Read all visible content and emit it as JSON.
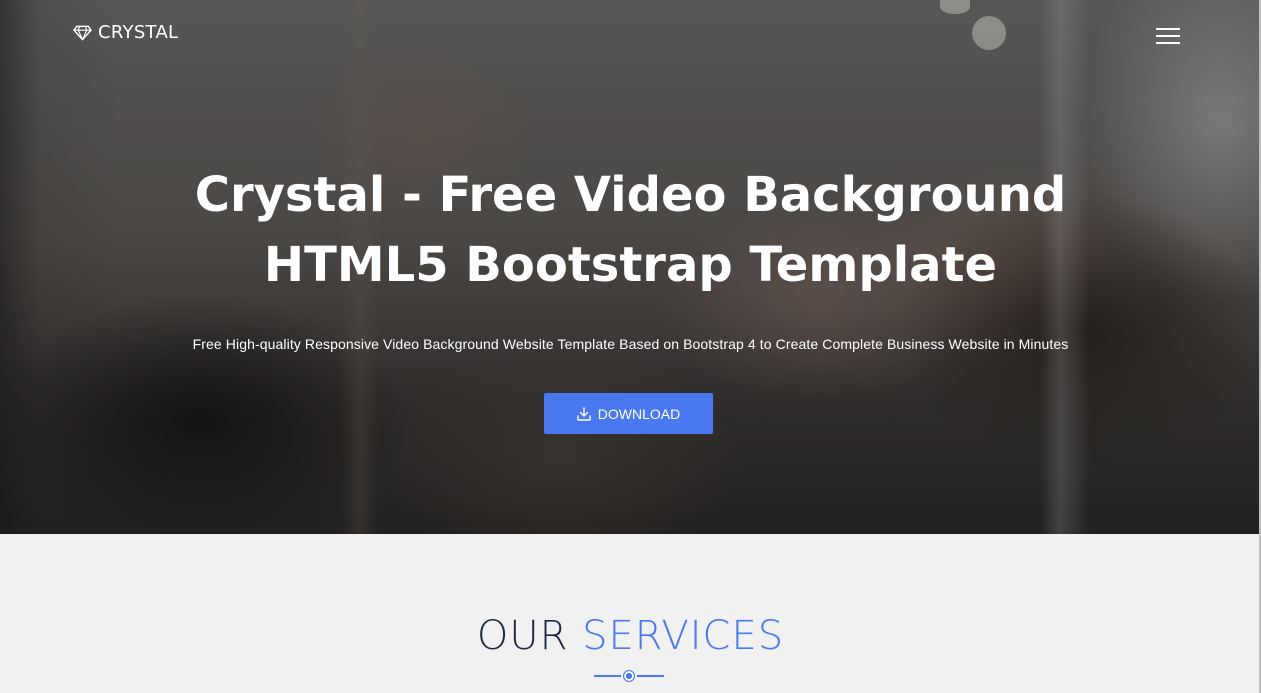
{
  "nav": {
    "brand": "CRYSTAL",
    "brand_icon": "diamond-icon",
    "menu_icon": "hamburger-menu-icon"
  },
  "hero": {
    "title": "Crystal - Free Video Background HTML5 Bootstrap Template",
    "subtitle": "Free High-quality Responsive Video Background Website Template Based on Bootstrap 4 to Create Complete Business Website in Minutes",
    "button_label": "DOWNLOAD",
    "button_icon": "download-icon"
  },
  "services": {
    "title_part1": "OUR",
    "title_part2": "SERVICES"
  },
  "colors": {
    "accent": "#4a78f0",
    "heading_dark": "#1e2a44",
    "section_bg": "#f1f1f1"
  }
}
